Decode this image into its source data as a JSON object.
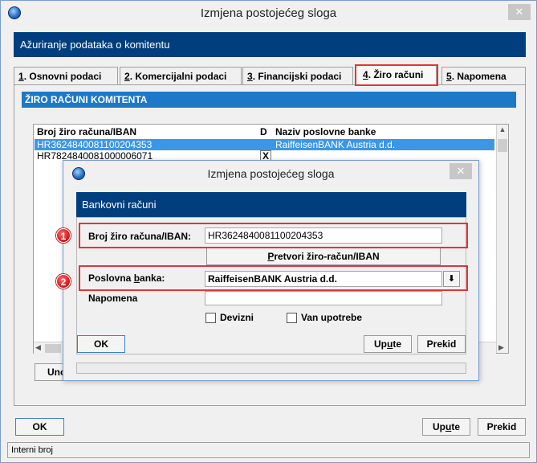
{
  "window": {
    "title": "Izmjena postojećeg sloga",
    "close_glyph": "✕"
  },
  "header": {
    "title": "Ažuriranje podataka o komitentu"
  },
  "tabs": [
    {
      "key": "1",
      "label": ". Osnovni podaci"
    },
    {
      "key": "2",
      "label": ". Komercijalni podaci"
    },
    {
      "key": "3",
      "label": ". Financijski podaci"
    },
    {
      "key": "4",
      "label": ". Žiro računi"
    },
    {
      "key": "5",
      "label": ". Napomena"
    }
  ],
  "section": {
    "title": "ŽIRO RAČUNI KOMITENTA"
  },
  "grid": {
    "columns": [
      "Broj žiro računa/IBAN",
      "D",
      "Naziv poslovne banke"
    ],
    "rows": [
      {
        "iban": "HR3624840081100204353",
        "d": "",
        "bank": "RaiffeisenBANK Austria d.d."
      },
      {
        "iban": "HR7824840081000006071",
        "d": "X",
        "bank": ""
      }
    ]
  },
  "partial_button": {
    "label": "Uno"
  },
  "footer": {
    "ok": "OK",
    "upute_pre": "Up",
    "upute_u": "u",
    "upute_post": "te",
    "prekid": "Prekid"
  },
  "statusbar": {
    "text": "Interni broj"
  },
  "dialog": {
    "title": "Izmjena postojećeg sloga",
    "close_glyph": "✕",
    "header": "Bankovni računi",
    "iban_label": "Broj žiro računa/IBAN:",
    "iban_value": "HR3624840081100204353",
    "convert_pre": "",
    "convert_u": "P",
    "convert_post": "retvori žiro-račun/IBAN",
    "bank_label_pre": "Poslovna ",
    "bank_label_u": "b",
    "bank_label_post": "anka:",
    "bank_value": "RaiffeisenBANK Austria d.d.",
    "note_label": "Napomena",
    "devizni": "Devizni",
    "van_upotrebe": "Van upotrebe",
    "ok": "OK",
    "upute_pre": "Up",
    "upute_u": "u",
    "upute_post": "te",
    "prekid": "Prekid",
    "badge1": "1",
    "badge2": "2",
    "dropdown_glyph": "⬇"
  }
}
